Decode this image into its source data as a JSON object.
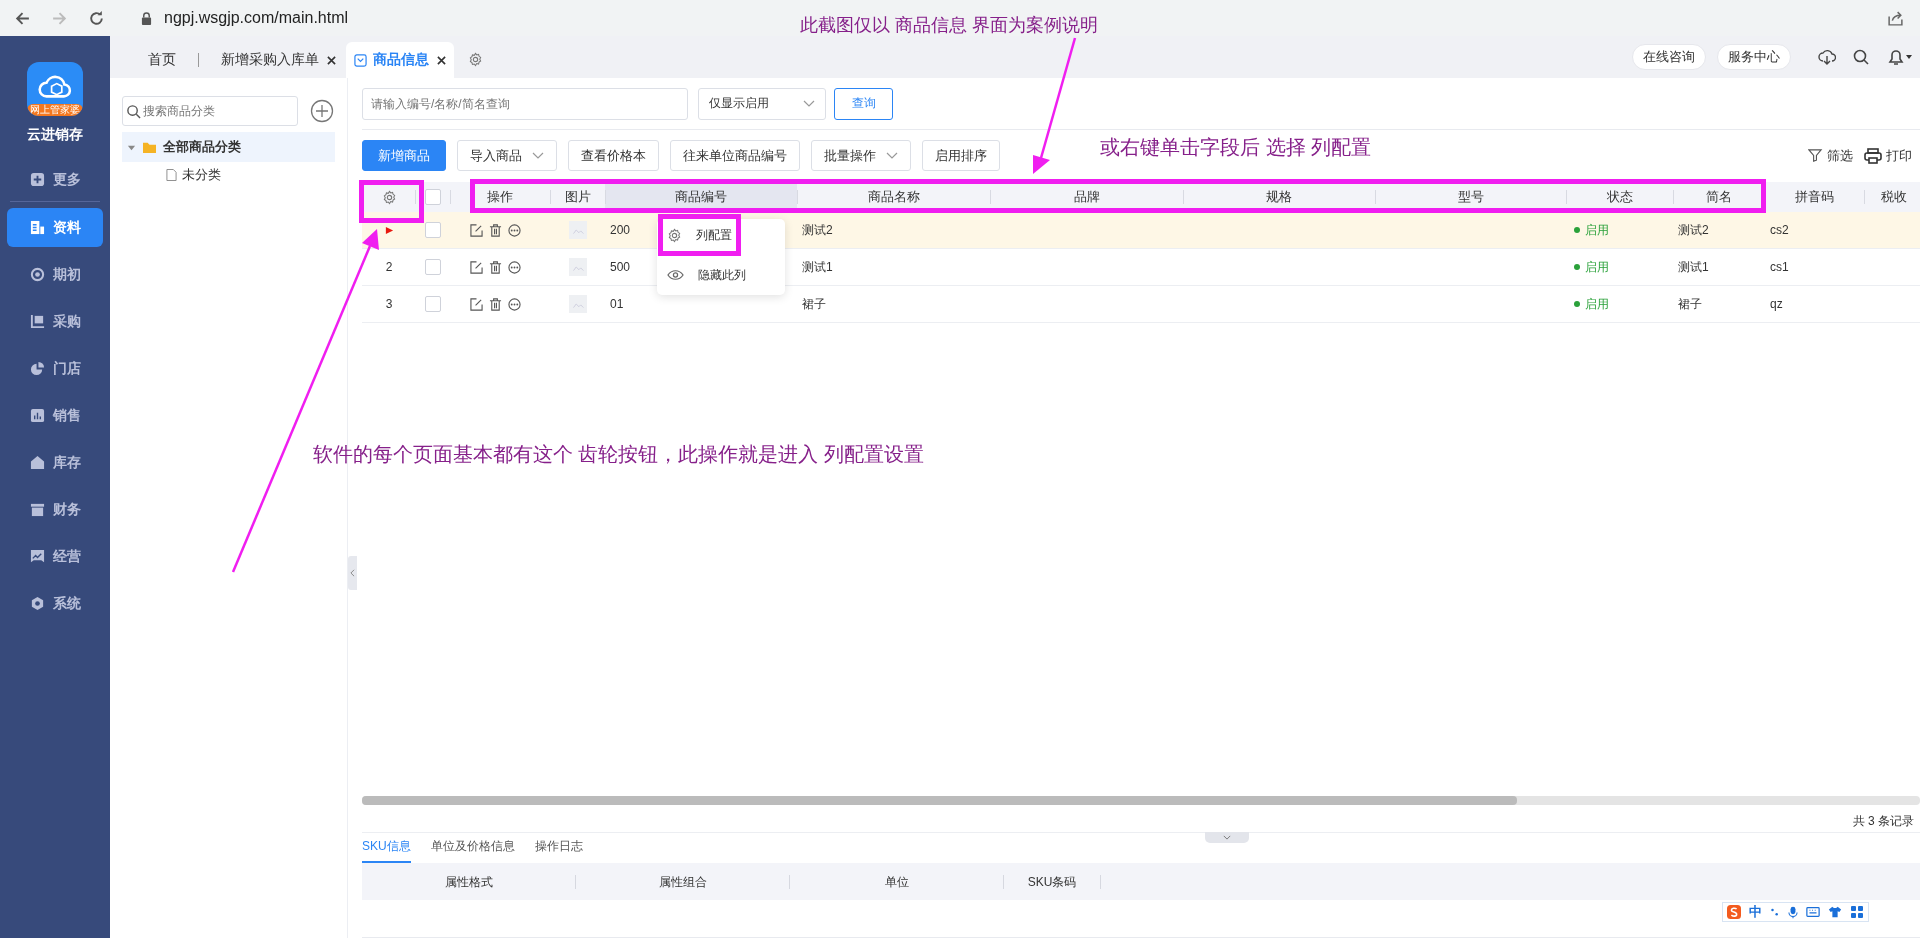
{
  "browser": {
    "url": "ngpj.wsgjp.com/main.html",
    "forward_disabled": true
  },
  "sidebar": {
    "logo_badge": "网上管家婆",
    "app_name": "云进销存",
    "items": [
      {
        "label": "更多",
        "selected": false
      },
      {
        "label": "资料",
        "selected": true
      },
      {
        "label": "期初",
        "selected": false
      },
      {
        "label": "采购",
        "selected": false
      },
      {
        "label": "门店",
        "selected": false
      },
      {
        "label": "销售",
        "selected": false
      },
      {
        "label": "库存",
        "selected": false
      },
      {
        "label": "财务",
        "selected": false
      },
      {
        "label": "经营",
        "selected": false
      },
      {
        "label": "系统",
        "selected": false
      }
    ]
  },
  "tabs": [
    {
      "label": "首页",
      "selected": false,
      "closable": false
    },
    {
      "label": "新增采购入库单",
      "selected": false,
      "closable": true
    },
    {
      "label": "商品信息",
      "selected": true,
      "closable": true
    }
  ],
  "header_buttons": [
    "在线咨询",
    "服务中心"
  ],
  "category_panel": {
    "search_placeholder": "搜索商品分类",
    "tree": [
      {
        "label": "全部商品分类",
        "expanded": true,
        "selected": true,
        "children": [
          {
            "label": "未分类",
            "selected": false
          }
        ]
      }
    ]
  },
  "filter": {
    "search_placeholder": "请输入编号/名称/简名查询",
    "status_select": "仅显示启用",
    "query_button": "查询"
  },
  "toolbar": {
    "buttons": [
      {
        "label": "新增商品",
        "kind": "primary"
      },
      {
        "label": "导入商品",
        "kind": "dropdown"
      },
      {
        "label": "查看价格本",
        "kind": "plain"
      },
      {
        "label": "往来单位商品编号",
        "kind": "plain"
      },
      {
        "label": "批量操作",
        "kind": "dropdown"
      },
      {
        "label": "启用排序",
        "kind": "plain"
      }
    ],
    "right_actions": [
      "筛选",
      "打印"
    ]
  },
  "table": {
    "all_checked": false,
    "columns": [
      {
        "label": "操作",
        "highlighted": false
      },
      {
        "label": "图片",
        "highlighted": false
      },
      {
        "label": "商品编号",
        "highlighted": true
      },
      {
        "label": "商品名称",
        "highlighted": false
      },
      {
        "label": "品牌",
        "highlighted": false
      },
      {
        "label": "规格",
        "highlighted": false
      },
      {
        "label": "型号",
        "highlighted": false
      },
      {
        "label": "状态",
        "highlighted": false
      },
      {
        "label": "简名",
        "highlighted": false
      },
      {
        "label": "拼音码",
        "highlighted": false
      },
      {
        "label": "税收",
        "highlighted": false
      }
    ],
    "rows": [
      {
        "current": true,
        "selected": true,
        "code": "200",
        "name": "测试2",
        "status": "启用",
        "short_name": "测试2",
        "pinyin": "cs2"
      },
      {
        "current": false,
        "index": "2",
        "selected": false,
        "code": "500",
        "name": "测试1",
        "status": "启用",
        "short_name": "测试1",
        "pinyin": "cs1"
      },
      {
        "current": false,
        "index": "3",
        "selected": false,
        "code": "01",
        "name": "裙子",
        "status": "启用",
        "short_name": "裙子",
        "pinyin": "qz"
      }
    ],
    "record_count": "共 3 条记录"
  },
  "context_menu": {
    "items": [
      "列配置",
      "隐藏此列"
    ]
  },
  "detail": {
    "tabs": [
      {
        "label": "SKU信息",
        "selected": true
      },
      {
        "label": "单位及价格信息",
        "selected": false
      },
      {
        "label": "操作日志",
        "selected": false
      }
    ],
    "columns": [
      "属性格式",
      "属性组合",
      "单位",
      "SKU条码"
    ]
  },
  "ime": {
    "label": "中"
  },
  "annotations": [
    "此截图仅以 商品信息 界面为案例说明",
    "或右键单击字段后  选择 列配置",
    "软件的每个页面基本都有这个 齿轮按钮，此操作就是进入 列配置设置"
  ]
}
